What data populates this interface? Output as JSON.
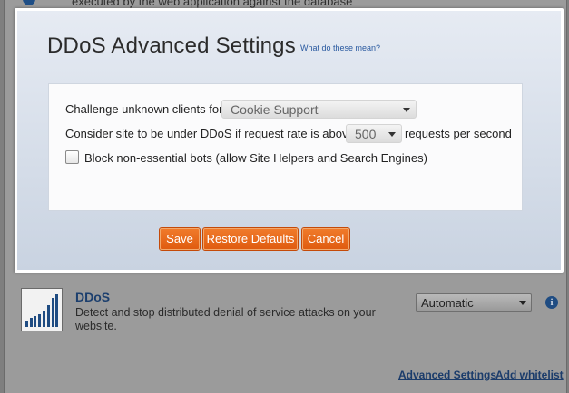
{
  "background": {
    "top_text": "executed by the web application against the database",
    "feature": {
      "title": "DDoS",
      "description": "Detect and stop distributed denial of service attacks on your website.",
      "mode_value": "Automatic",
      "info_glyph": "i"
    },
    "links": {
      "advanced": "Advanced Settings",
      "whitelist": "Add whitelist"
    }
  },
  "modal": {
    "title": "DDoS Advanced Settings",
    "help_link": "What do these mean?",
    "challenge": {
      "label": "Challenge unknown clients for",
      "value": "Cookie Support"
    },
    "rate": {
      "label": "Consider site to be under DDoS if request rate is above",
      "value": "500",
      "suffix": "requests per second"
    },
    "block_bots": {
      "label": "Block non-essential bots (allow Site Helpers and Search Engines)",
      "checked": false
    },
    "buttons": {
      "save": "Save",
      "restore": "Restore Defaults",
      "cancel": "Cancel"
    }
  },
  "colors": {
    "accent_orange": "#e8661a",
    "link_blue": "#2a5aa0",
    "brand_navy": "#1f4c82"
  }
}
